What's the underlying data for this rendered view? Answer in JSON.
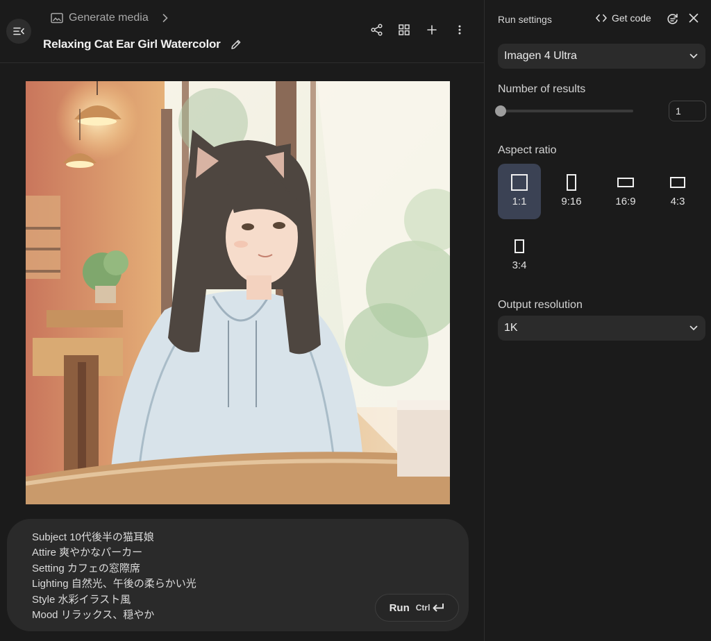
{
  "header": {
    "breadcrumb": "Generate media",
    "title": "Relaxing Cat Ear Girl Watercolor"
  },
  "prompt": {
    "lines": [
      "Subject 10代後半の猫耳娘",
      "Attire 爽やかなパーカー",
      "Setting カフェの窓際席",
      "Lighting 自然光、午後の柔らかい光",
      "Style 水彩イラスト風",
      "Mood リラックス、穏やか"
    ],
    "run_label": "Run",
    "shortcut": "Ctrl"
  },
  "panel": {
    "title": "Run settings",
    "get_code": "Get code",
    "model": "Imagen 4 Ultra",
    "results_label": "Number of results",
    "results_value": "1",
    "results_fraction": 0,
    "aspect_label": "Aspect ratio",
    "aspect_ratios": [
      "1:1",
      "9:16",
      "16:9",
      "4:3",
      "3:4"
    ],
    "aspect_selected": "1:1",
    "resolution_label": "Output resolution",
    "resolution": "1K"
  },
  "colors": {
    "background": "#1b1b1b",
    "surface": "#2b2b2b",
    "selected": "#3b4254",
    "text": "#e3e3e3",
    "muted": "#a8a8a8"
  },
  "icons": {
    "menu": "collapse-menu-icon",
    "breadcrumb": "image-icon",
    "share": "share-icon",
    "grid": "grid-icon",
    "add": "plus-icon",
    "more": "more-vert-icon",
    "edit": "pencil-icon",
    "code": "code-icon",
    "reset": "reset-settings-icon",
    "close": "close-icon",
    "dropdown": "chevron-down-icon",
    "enter": "enter-key-icon"
  }
}
